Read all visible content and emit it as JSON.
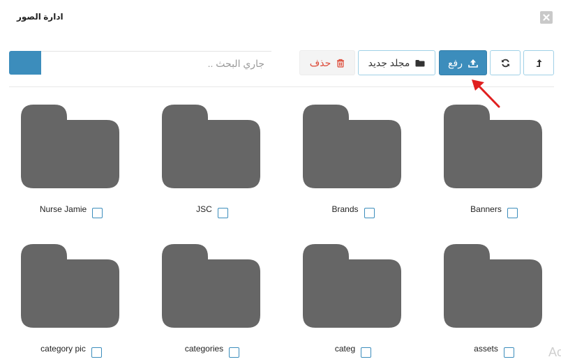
{
  "modal": {
    "title": "ادارة الصور",
    "close_icon": "close-icon"
  },
  "search": {
    "placeholder": "جاري البحث ..",
    "button_icon": "search-go-button"
  },
  "toolbar": {
    "delete_label": "حذف",
    "delete_icon": "trash-icon",
    "new_folder_label": "مجلد جديد",
    "new_folder_icon": "folder-icon",
    "upload_label": "رفع",
    "upload_icon": "upload-icon",
    "refresh_icon": "refresh-icon",
    "parent_icon": "level-up-icon"
  },
  "folders": [
    {
      "name": "Nurse Jamie"
    },
    {
      "name": "JSC"
    },
    {
      "name": "Brands"
    },
    {
      "name": "Banners"
    },
    {
      "name": "category pic"
    },
    {
      "name": "categories"
    },
    {
      "name": "categ"
    },
    {
      "name": "assets"
    }
  ],
  "watermark": "Ac",
  "colors": {
    "primary": "#3c8dbc",
    "danger": "#dd4b39",
    "folder": "#666666",
    "annotation": "#e02020"
  }
}
